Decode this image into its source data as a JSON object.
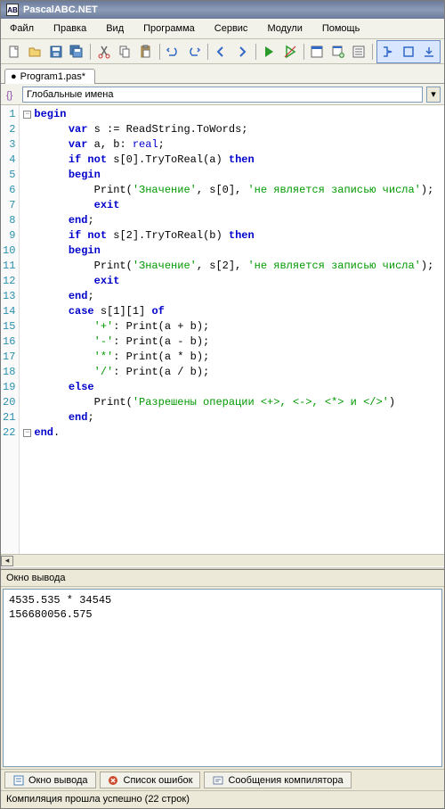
{
  "titlebar": {
    "icon_text": "AB",
    "title": "PascalABC.NET"
  },
  "menu": [
    "Файл",
    "Правка",
    "Вид",
    "Программа",
    "Сервис",
    "Модули",
    "Помощь"
  ],
  "tab": {
    "dirty": "●",
    "name": "Program1.pas*"
  },
  "scope": {
    "value": "Глобальные имена"
  },
  "code": {
    "lines": [
      {
        "n": "1",
        "fold": "-",
        "ind": 0,
        "tok": [
          [
            "kw",
            "begin"
          ]
        ]
      },
      {
        "n": "2",
        "ind": 2,
        "tok": [
          [
            "kw",
            "var"
          ],
          [
            "",
            " s := ReadString.ToWords;"
          ]
        ]
      },
      {
        "n": "3",
        "ind": 2,
        "tok": [
          [
            "kw",
            "var"
          ],
          [
            "",
            " a, b: "
          ],
          [
            "ty",
            "real"
          ],
          [
            "",
            ";"
          ]
        ]
      },
      {
        "n": "4",
        "ind": 2,
        "tok": [
          [
            "kw",
            "if not"
          ],
          [
            "",
            " s[0].TryToReal(a) "
          ],
          [
            "kw",
            "then"
          ]
        ]
      },
      {
        "n": "5",
        "ind": 2,
        "tok": [
          [
            "kw",
            "begin"
          ]
        ]
      },
      {
        "n": "6",
        "ind": 4,
        "tok": [
          [
            "",
            "Print("
          ],
          [
            "str",
            "'Значение'"
          ],
          [
            "",
            ", s[0], "
          ],
          [
            "str",
            "'не является записью числа'"
          ],
          [
            "",
            ");"
          ]
        ]
      },
      {
        "n": "7",
        "ind": 4,
        "tok": [
          [
            "kw",
            "exit"
          ]
        ]
      },
      {
        "n": "8",
        "ind": 2,
        "tok": [
          [
            "kw",
            "end"
          ],
          [
            "",
            ";"
          ]
        ]
      },
      {
        "n": "9",
        "ind": 2,
        "tok": [
          [
            "kw",
            "if not"
          ],
          [
            "",
            " s[2].TryToReal(b) "
          ],
          [
            "kw",
            "then"
          ]
        ]
      },
      {
        "n": "10",
        "ind": 2,
        "tok": [
          [
            "kw",
            "begin"
          ]
        ]
      },
      {
        "n": "11",
        "ind": 4,
        "tok": [
          [
            "",
            "Print("
          ],
          [
            "str",
            "'Значение'"
          ],
          [
            "",
            ", s[2], "
          ],
          [
            "str",
            "'не является записью числа'"
          ],
          [
            "",
            ");"
          ]
        ]
      },
      {
        "n": "12",
        "ind": 4,
        "tok": [
          [
            "kw",
            "exit"
          ]
        ]
      },
      {
        "n": "13",
        "ind": 2,
        "tok": [
          [
            "kw",
            "end"
          ],
          [
            "",
            ";"
          ]
        ]
      },
      {
        "n": "14",
        "ind": 2,
        "tok": [
          [
            "kw",
            "case"
          ],
          [
            "",
            " s[1][1] "
          ],
          [
            "kw",
            "of"
          ]
        ]
      },
      {
        "n": "15",
        "ind": 4,
        "tok": [
          [
            "str",
            "'+'"
          ],
          [
            "",
            ": Print(a + b);"
          ]
        ]
      },
      {
        "n": "16",
        "ind": 4,
        "tok": [
          [
            "str",
            "'-'"
          ],
          [
            "",
            ": Print(a - b);"
          ]
        ]
      },
      {
        "n": "17",
        "ind": 4,
        "tok": [
          [
            "str",
            "'*'"
          ],
          [
            "",
            ": Print(a * b);"
          ]
        ]
      },
      {
        "n": "18",
        "ind": 4,
        "tok": [
          [
            "str",
            "'/'"
          ],
          [
            "",
            ": Print(a / b);"
          ]
        ]
      },
      {
        "n": "19",
        "ind": 2,
        "tok": [
          [
            "kw",
            "else"
          ]
        ]
      },
      {
        "n": "20",
        "ind": 4,
        "tok": [
          [
            "",
            "Print("
          ],
          [
            "str",
            "'Разрешены операции <+>, <->, <*> и </>'"
          ],
          [
            "",
            ")"
          ]
        ]
      },
      {
        "n": "21",
        "ind": 2,
        "tok": [
          [
            "kw",
            "end"
          ],
          [
            "",
            ";"
          ]
        ]
      },
      {
        "n": "22",
        "fold": "-",
        "ind": 0,
        "tok": [
          [
            "kw",
            "end"
          ],
          [
            "",
            "."
          ]
        ]
      }
    ]
  },
  "output_panel": {
    "title": "Окно вывода",
    "content": "4535.535 * 34545\n156680056.575"
  },
  "bottom_tabs": [
    {
      "name": "output",
      "label": "Окно вывода",
      "color": "#4a7db3"
    },
    {
      "name": "errors",
      "label": "Список ошибок",
      "color": "#cc4a2d"
    },
    {
      "name": "compiler",
      "label": "Сообщения компилятора",
      "color": "#6b7d9f"
    }
  ],
  "status": {
    "text": "Компиляция прошла успешно (22 строк)"
  }
}
